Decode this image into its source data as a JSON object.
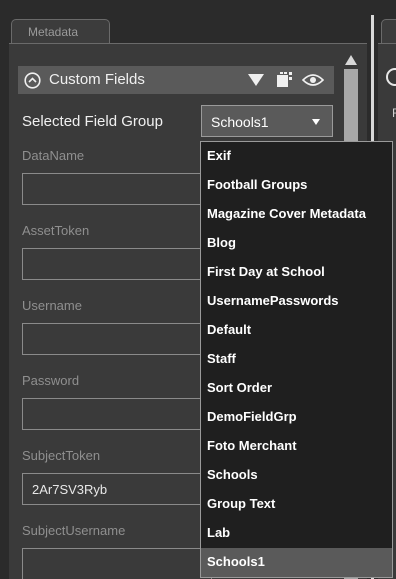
{
  "tabs": {
    "left_label": "Metadata"
  },
  "right_panel": {
    "letter": "R"
  },
  "section": {
    "title": "Custom Fields"
  },
  "field_group": {
    "label": "Selected Field Group",
    "selected": "Schools1"
  },
  "fields": [
    {
      "label": "DataName",
      "value": ""
    },
    {
      "label": "AssetToken",
      "value": ""
    },
    {
      "label": "Username",
      "value": ""
    },
    {
      "label": "Password",
      "value": ""
    },
    {
      "label": "SubjectToken",
      "value": "2Ar7SV3Ryb"
    },
    {
      "label": "SubjectUsername",
      "value": ""
    }
  ],
  "dropdown": {
    "options": [
      "Exif",
      "Football Groups",
      "Magazine Cover Metadata",
      "Blog",
      "First Day at School",
      "UsernamePasswords",
      "Default",
      "Staff",
      "Sort Order",
      "DemoFieldGrp",
      "Foto Merchant",
      "Schools",
      "Group Text",
      "Lab",
      "Schools1"
    ],
    "selected_index": 14
  },
  "icons": {
    "collapse": "chevron-up-circle-icon",
    "dropdown": "triangle-down-icon",
    "columns": "columns-icon",
    "visibility": "eye-icon",
    "scroll_up": "scroll-up-arrow-icon",
    "select_arrow": "chevron-down-icon"
  },
  "colors": {
    "background": "#2b2b2b",
    "panel": "#3a3a3a",
    "header": "#5a5a5a",
    "list_background": "#1f1f1f",
    "list_selected": "#5a5a5a",
    "label": "#8f8f8f"
  }
}
